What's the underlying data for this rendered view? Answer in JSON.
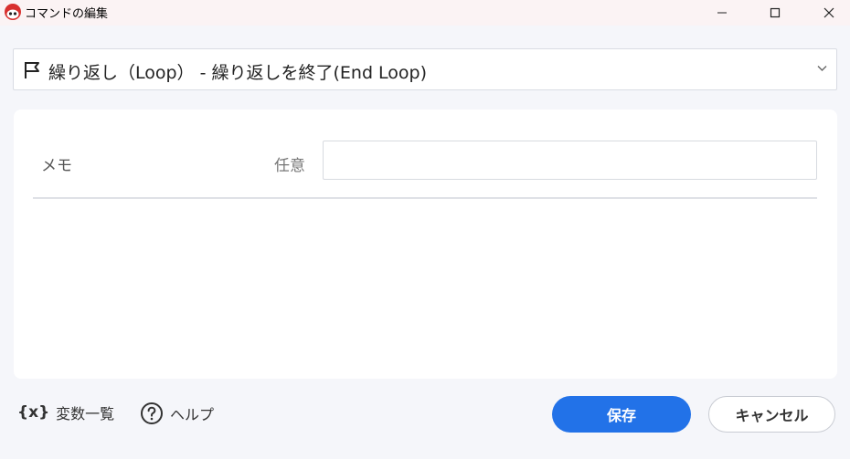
{
  "window": {
    "title": "コマンドの編集",
    "app_icon": "app-logo-icon",
    "controls": [
      "minimize-icon",
      "maximize-icon",
      "close-icon"
    ]
  },
  "command_select": {
    "icon": "flag-icon",
    "value": "繰り返し（Loop） - 繰り返しを終了(End Loop)",
    "dropdown_icon": "chevron-down-icon"
  },
  "form": {
    "memo_label": "メモ",
    "memo_optional_label": "任意",
    "memo_value": ""
  },
  "footer": {
    "variables_icon": "{x}",
    "variables_label": "変数一覧",
    "help_icon": "question-circle-icon",
    "help_label": "ヘルプ",
    "save_label": "保存",
    "cancel_label": "キャンセル"
  },
  "colors": {
    "accent": "#2272e8",
    "background": "#f5f6fa",
    "titlebar": "#fbf3f4",
    "app_icon_red": "#d8302e"
  }
}
